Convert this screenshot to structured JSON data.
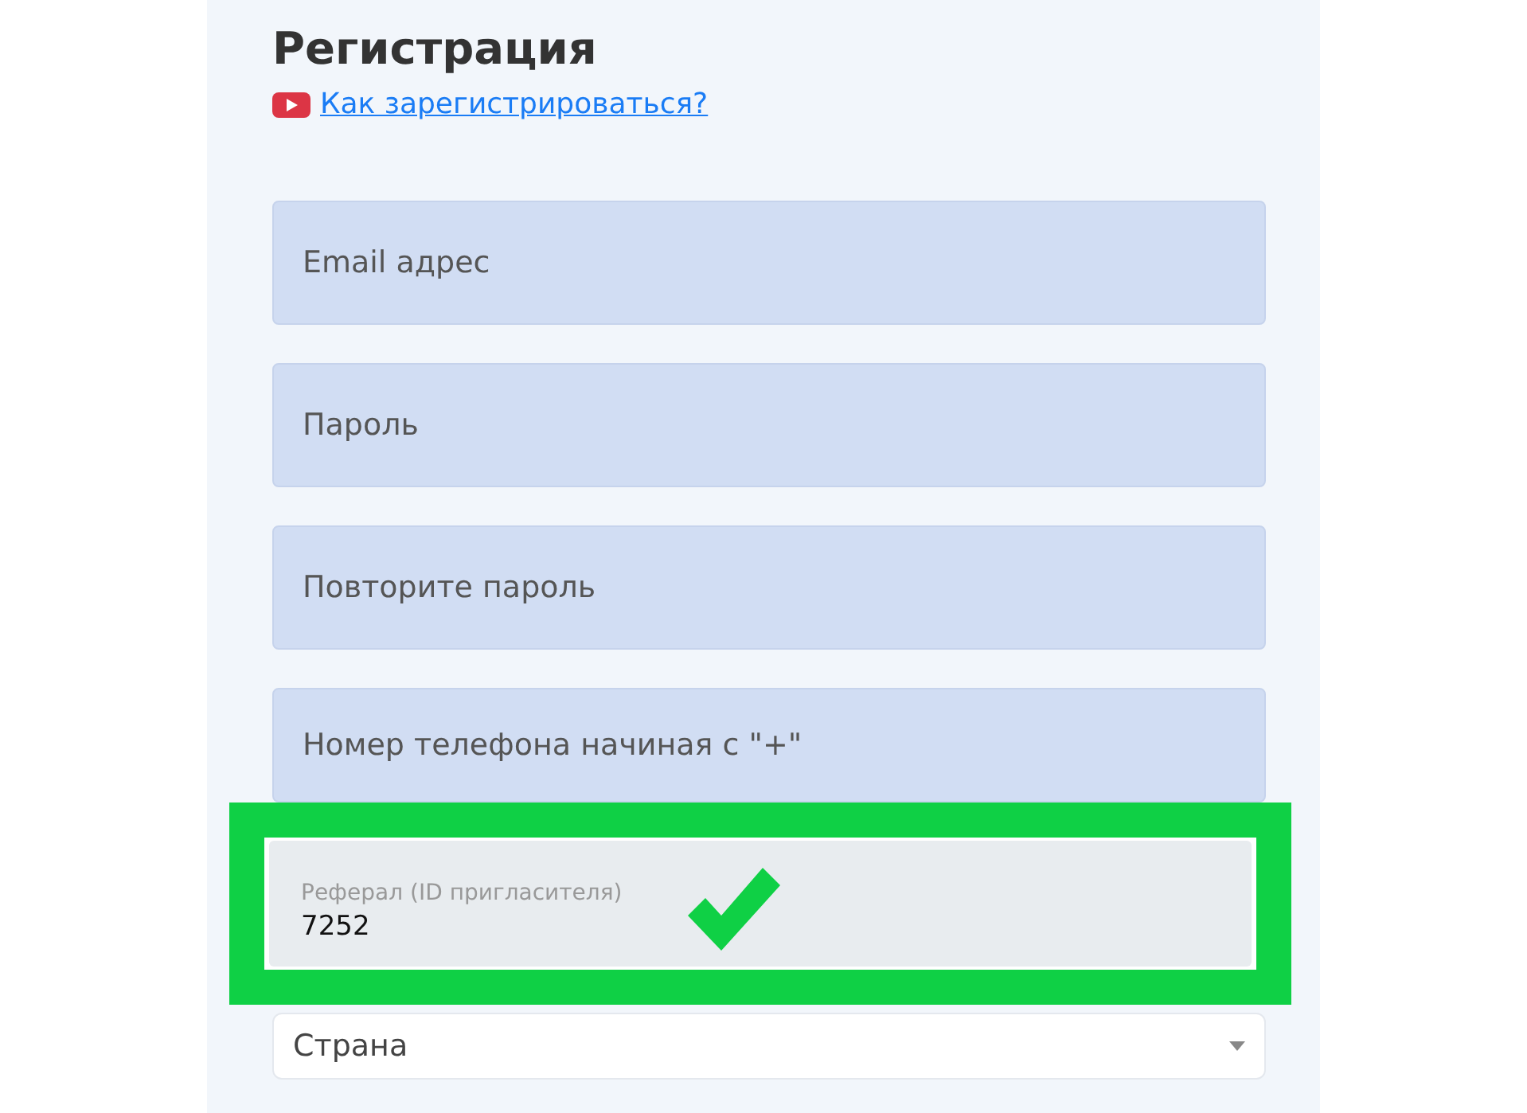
{
  "title": "Регистрация",
  "help_link": {
    "text": "Как зарегистрироваться?"
  },
  "fields": [
    {
      "placeholder": "Email адрес"
    },
    {
      "placeholder": "Пароль"
    },
    {
      "placeholder": "Повторите пароль"
    },
    {
      "placeholder": "Номер телефона начиная с \"+\""
    }
  ],
  "referral": {
    "label": "Реферал (ID пригласителя)",
    "value": "7252",
    "highlighted": true,
    "verified": true
  },
  "country": {
    "placeholder": "Страна"
  }
}
